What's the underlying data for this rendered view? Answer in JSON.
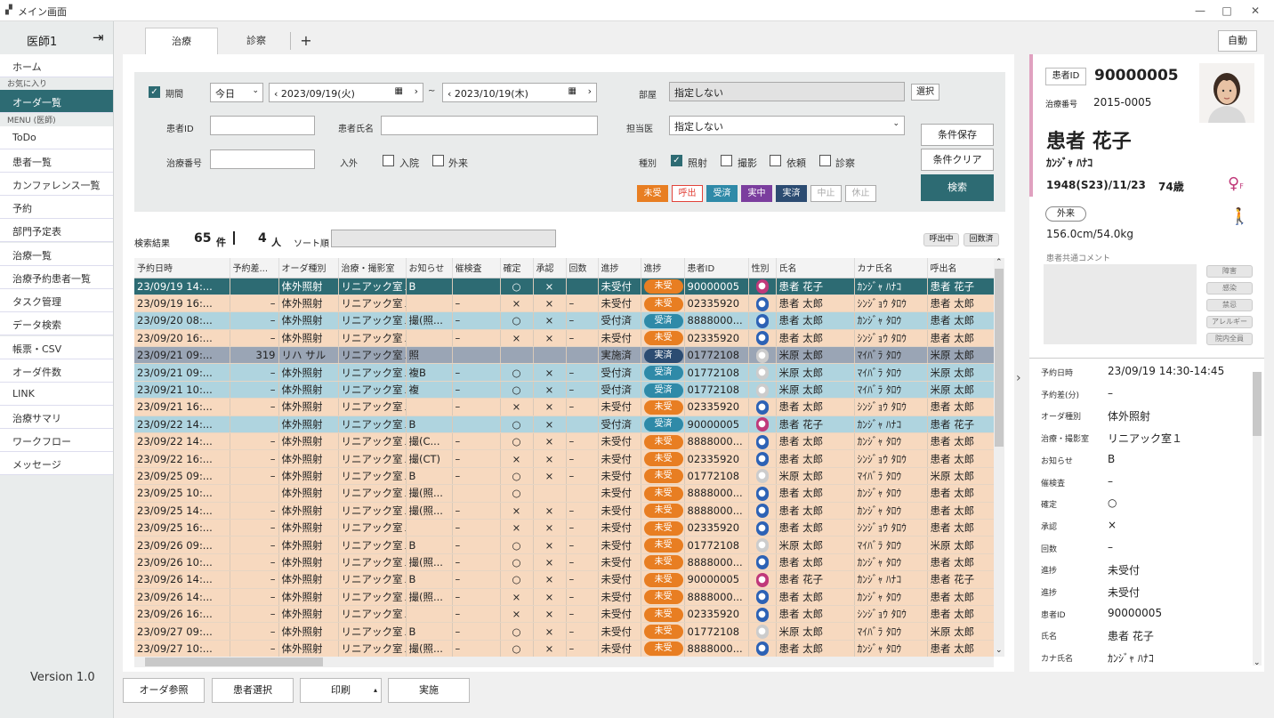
{
  "window": {
    "title": "メイン画面",
    "minimize": "—",
    "maximize": "□",
    "close": "✕"
  },
  "sidebar": {
    "user": "医師1",
    "cat_fav": "お気に入り",
    "cat_menu": "MENU (医師)",
    "version": "Version 1.0",
    "items": [
      "ホーム",
      "オーダ一覧",
      "ToDo",
      "患者一覧",
      "カンファレンス一覧",
      "予約",
      "部門予定表",
      "治療一覧",
      "治療予約患者一覧",
      "タスク管理",
      "データ検索",
      "帳票・CSV",
      "オーダ件数",
      "LINK",
      "治療サマリ",
      "ワークフロー",
      "メッセージ"
    ]
  },
  "tabs": [
    "治療",
    "診察"
  ],
  "tab_add": "+",
  "auto_button": "自動",
  "search": {
    "period_label": "期間",
    "today": "今日",
    "date_from": "2023/09/19(火)",
    "tilde": "~",
    "date_to": "2023/10/19(木)",
    "patient_id_label": "患者ID",
    "patient_name_label": "患者氏名",
    "treat_no_label": "治療番号",
    "inout_label": "入外",
    "inpatient": "入院",
    "outpatient": "外来",
    "dept_label": "部屋",
    "dept_value": "指定しない",
    "select_button": "選択",
    "staff_label": "担当医",
    "staff_value": "指定しない",
    "type_label": "種別",
    "type_irr": "照射",
    "type_img": "撮影",
    "type_req": "依頼",
    "type_exam": "診察",
    "save_cond": "条件保存",
    "clear_cond": "条件クリア",
    "search_button": "検索",
    "statuses": [
      {
        "label": "未受",
        "bg": "#e87e22",
        "fg": "#ffffff",
        "border": "#e87e22"
      },
      {
        "label": "呼出",
        "bg": "#ffffff",
        "fg": "#e2433a",
        "border": "#e2433a"
      },
      {
        "label": "受済",
        "bg": "#2f8aa8",
        "fg": "#ffffff",
        "border": "#2f8aa8"
      },
      {
        "label": "実中",
        "bg": "#7b3e9e",
        "fg": "#ffffff",
        "border": "#7b3e9e"
      },
      {
        "label": "実済",
        "bg": "#2c4c72",
        "fg": "#ffffff",
        "border": "#2c4c72"
      },
      {
        "label": "中止",
        "bg": "#ffffff",
        "fg": "#aaaaaa",
        "border": "#aaaaaa"
      },
      {
        "label": "休止",
        "bg": "#ffffff",
        "fg": "#aaaaaa",
        "border": "#aaaaaa"
      }
    ]
  },
  "results": {
    "label": "検索結果",
    "count": "65",
    "count_unit": "件",
    "people": "4",
    "people_unit": "人",
    "sort_label": "ソート順",
    "btn_calling": "呼出中",
    "btn_registered": "回数済"
  },
  "table": {
    "headers": [
      "予約日時",
      "予約差...",
      "オーダ種別",
      "治療・撮影室",
      "お知らせ",
      "催検査",
      "確定",
      "承認",
      "回数",
      "進捗",
      "進捗",
      "患者ID",
      "性別",
      "氏名",
      "カナ氏名",
      "呼出名"
    ],
    "rows": [
      {
        "style": "sel",
        "date": "23/09/19  14:...",
        "diff": "",
        "order": "体外照射",
        "room": "リニアック室１",
        "notice": "B",
        "exam": "",
        "kakutei": "○",
        "shonin": "×",
        "count": "",
        "prog": "未受付",
        "status": "未受",
        "stcls": "st-orange",
        "pid": "90000005",
        "sex": "f",
        "name": "患者  花子",
        "kana": "ｶﾝｼﾞｬ ﾊﾅｺ",
        "call": "患者  花子"
      },
      {
        "style": "peach",
        "date": "23/09/19  16:...",
        "diff": "–",
        "order": "体外照射",
        "room": "リニアック室１",
        "notice": "",
        "exam": "–",
        "kakutei": "×",
        "shonin": "×",
        "count": "–",
        "prog": "未受付",
        "status": "未受",
        "stcls": "st-orange",
        "pid": "02335920",
        "sex": "m",
        "name": "患者  太郎",
        "kana": "ｼﾝｼﾞｮｳ ﾀﾛｳ",
        "call": "患者  太郎"
      },
      {
        "style": "blue",
        "date": "23/09/20  08:...",
        "diff": "–",
        "order": "体外照射",
        "room": "リニアック室１",
        "notice": "撮(照...",
        "exam": "–",
        "kakutei": "○",
        "shonin": "×",
        "count": "–",
        "prog": "受付済",
        "status": "受済",
        "stcls": "st-teal",
        "pid": "8888000...",
        "sex": "m",
        "name": "患者  太郎",
        "kana": "ｶﾝｼﾞｬ ﾀﾛｳ",
        "call": "患者  太郎"
      },
      {
        "style": "peach",
        "date": "23/09/20  16:...",
        "diff": "–",
        "order": "体外照射",
        "room": "リニアック室１",
        "notice": "",
        "exam": "–",
        "kakutei": "×",
        "shonin": "×",
        "count": "–",
        "prog": "未受付",
        "status": "未受",
        "stcls": "st-orange",
        "pid": "02335920",
        "sex": "m",
        "name": "患者  太郎",
        "kana": "ｼﾝｼﾞｮｳ ﾀﾛｳ",
        "call": "患者  太郎"
      },
      {
        "style": "gray",
        "date": "23/09/21  09:...",
        "diff": "319",
        "order": "リハ  サル",
        "room": "リニアック室１",
        "notice": "照",
        "exam": "",
        "kakutei": "",
        "shonin": "",
        "count": "",
        "prog": "実施済",
        "status": "実済",
        "stcls": "st-navy",
        "pid": "01772108",
        "sex": "u",
        "name": "米原  太郎",
        "kana": "ﾏｲﾊﾞﾗ ﾀﾛｳ",
        "call": "米原  太郎"
      },
      {
        "style": "blue",
        "date": "23/09/21  09:...",
        "diff": "–",
        "order": "体外照射",
        "room": "リニアック室１",
        "notice": "複B",
        "exam": "–",
        "kakutei": "○",
        "shonin": "×",
        "count": "–",
        "prog": "受付済",
        "status": "受済",
        "stcls": "st-teal",
        "pid": "01772108",
        "sex": "u",
        "name": "米原  太郎",
        "kana": "ﾏｲﾊﾞﾗ ﾀﾛｳ",
        "call": "米原  太郎"
      },
      {
        "style": "blue",
        "date": "23/09/21  10:...",
        "diff": "–",
        "order": "体外照射",
        "room": "リニアック室１",
        "notice": "複",
        "exam": "–",
        "kakutei": "○",
        "shonin": "×",
        "count": "–",
        "prog": "受付済",
        "status": "受済",
        "stcls": "st-teal",
        "pid": "01772108",
        "sex": "u",
        "name": "米原  太郎",
        "kana": "ﾏｲﾊﾞﾗ ﾀﾛｳ",
        "call": "米原  太郎"
      },
      {
        "style": "peach",
        "date": "23/09/21  16:...",
        "diff": "–",
        "order": "体外照射",
        "room": "リニアック室１",
        "notice": "",
        "exam": "–",
        "kakutei": "×",
        "shonin": "×",
        "count": "–",
        "prog": "未受付",
        "status": "未受",
        "stcls": "st-orange",
        "pid": "02335920",
        "sex": "m",
        "name": "患者  太郎",
        "kana": "ｼﾝｼﾞｮｳ ﾀﾛｳ",
        "call": "患者  太郎"
      },
      {
        "style": "blue",
        "date": "23/09/22  14:...",
        "diff": "",
        "order": "体外照射",
        "room": "リニアック室１",
        "notice": "B",
        "exam": "",
        "kakutei": "○",
        "shonin": "×",
        "count": "",
        "prog": "受付済",
        "status": "受済",
        "stcls": "st-teal",
        "pid": "90000005",
        "sex": "f",
        "name": "患者  花子",
        "kana": "ｶﾝｼﾞｬ ﾊﾅｺ",
        "call": "患者  花子"
      },
      {
        "style": "peach",
        "date": "23/09/22  14:...",
        "diff": "–",
        "order": "体外照射",
        "room": "リニアック室１",
        "notice": "撮(C...",
        "exam": "–",
        "kakutei": "○",
        "shonin": "×",
        "count": "–",
        "prog": "未受付",
        "status": "未受",
        "stcls": "st-orange",
        "pid": "8888000...",
        "sex": "m",
        "name": "患者  太郎",
        "kana": "ｶﾝｼﾞｬ ﾀﾛｳ",
        "call": "患者  太郎"
      },
      {
        "style": "peach",
        "date": "23/09/22  16:...",
        "diff": "–",
        "order": "体外照射",
        "room": "リニアック室１",
        "notice": "撮(CT)",
        "exam": "–",
        "kakutei": "×",
        "shonin": "×",
        "count": "–",
        "prog": "未受付",
        "status": "未受",
        "stcls": "st-orange",
        "pid": "02335920",
        "sex": "m",
        "name": "患者  太郎",
        "kana": "ｼﾝｼﾞｮｳ ﾀﾛｳ",
        "call": "患者  太郎"
      },
      {
        "style": "peach",
        "date": "23/09/25  09:...",
        "diff": "–",
        "order": "体外照射",
        "room": "リニアック室１",
        "notice": "B",
        "exam": "–",
        "kakutei": "○",
        "shonin": "×",
        "count": "–",
        "prog": "未受付",
        "status": "未受",
        "stcls": "st-orange",
        "pid": "01772108",
        "sex": "u",
        "name": "米原  太郎",
        "kana": "ﾏｲﾊﾞﾗ ﾀﾛｳ",
        "call": "米原  太郎"
      },
      {
        "style": "peach",
        "date": "23/09/25  10:...",
        "diff": "",
        "order": "体外照射",
        "room": "リニアック室１",
        "notice": "撮(照...",
        "exam": "",
        "kakutei": "○",
        "shonin": "",
        "count": "",
        "prog": "未受付",
        "status": "未受",
        "stcls": "st-orange",
        "pid": "8888000...",
        "sex": "m",
        "name": "患者  太郎",
        "kana": "ｶﾝｼﾞｬ ﾀﾛｳ",
        "call": "患者  太郎"
      },
      {
        "style": "peach",
        "date": "23/09/25  14:...",
        "diff": "–",
        "order": "体外照射",
        "room": "リニアック室１",
        "notice": "撮(照...",
        "exam": "–",
        "kakutei": "×",
        "shonin": "×",
        "count": "–",
        "prog": "未受付",
        "status": "未受",
        "stcls": "st-orange",
        "pid": "8888000...",
        "sex": "m",
        "name": "患者  太郎",
        "kana": "ｶﾝｼﾞｬ ﾀﾛｳ",
        "call": "患者  太郎"
      },
      {
        "style": "peach",
        "date": "23/09/25  16:...",
        "diff": "–",
        "order": "体外照射",
        "room": "リニアック室１",
        "notice": "",
        "exam": "–",
        "kakutei": "×",
        "shonin": "×",
        "count": "–",
        "prog": "未受付",
        "status": "未受",
        "stcls": "st-orange",
        "pid": "02335920",
        "sex": "m",
        "name": "患者  太郎",
        "kana": "ｼﾝｼﾞｮｳ ﾀﾛｳ",
        "call": "患者  太郎"
      },
      {
        "style": "peach",
        "date": "23/09/26  09:...",
        "diff": "–",
        "order": "体外照射",
        "room": "リニアック室１",
        "notice": "B",
        "exam": "–",
        "kakutei": "○",
        "shonin": "×",
        "count": "–",
        "prog": "未受付",
        "status": "未受",
        "stcls": "st-orange",
        "pid": "01772108",
        "sex": "u",
        "name": "米原  太郎",
        "kana": "ﾏｲﾊﾞﾗ ﾀﾛｳ",
        "call": "米原  太郎"
      },
      {
        "style": "peach",
        "date": "23/09/26  10:...",
        "diff": "–",
        "order": "体外照射",
        "room": "リニアック室１",
        "notice": "撮(照...",
        "exam": "–",
        "kakutei": "○",
        "shonin": "×",
        "count": "–",
        "prog": "未受付",
        "status": "未受",
        "stcls": "st-orange",
        "pid": "8888000...",
        "sex": "m",
        "name": "患者  太郎",
        "kana": "ｶﾝｼﾞｬ ﾀﾛｳ",
        "call": "患者  太郎"
      },
      {
        "style": "peach",
        "date": "23/09/26  14:...",
        "diff": "–",
        "order": "体外照射",
        "room": "リニアック室１",
        "notice": "B",
        "exam": "–",
        "kakutei": "○",
        "shonin": "×",
        "count": "–",
        "prog": "未受付",
        "status": "未受",
        "stcls": "st-orange",
        "pid": "90000005",
        "sex": "f",
        "name": "患者  花子",
        "kana": "ｶﾝｼﾞｬ ﾊﾅｺ",
        "call": "患者  花子"
      },
      {
        "style": "peach",
        "date": "23/09/26  14:...",
        "diff": "–",
        "order": "体外照射",
        "room": "リニアック室１",
        "notice": "撮(照...",
        "exam": "–",
        "kakutei": "×",
        "shonin": "×",
        "count": "–",
        "prog": "未受付",
        "status": "未受",
        "stcls": "st-orange",
        "pid": "8888000...",
        "sex": "m",
        "name": "患者  太郎",
        "kana": "ｶﾝｼﾞｬ ﾀﾛｳ",
        "call": "患者  太郎"
      },
      {
        "style": "peach",
        "date": "23/09/26  16:...",
        "diff": "–",
        "order": "体外照射",
        "room": "リニアック室１",
        "notice": "",
        "exam": "–",
        "kakutei": "×",
        "shonin": "×",
        "count": "–",
        "prog": "未受付",
        "status": "未受",
        "stcls": "st-orange",
        "pid": "02335920",
        "sex": "m",
        "name": "患者  太郎",
        "kana": "ｼﾝｼﾞｮｳ ﾀﾛｳ",
        "call": "患者  太郎"
      },
      {
        "style": "peach",
        "date": "23/09/27  09:...",
        "diff": "–",
        "order": "体外照射",
        "room": "リニアック室１",
        "notice": "B",
        "exam": "–",
        "kakutei": "○",
        "shonin": "×",
        "count": "–",
        "prog": "未受付",
        "status": "未受",
        "stcls": "st-orange",
        "pid": "01772108",
        "sex": "u",
        "name": "米原  太郎",
        "kana": "ﾏｲﾊﾞﾗ ﾀﾛｳ",
        "call": "米原  太郎"
      },
      {
        "style": "peach",
        "date": "23/09/27  10:...",
        "diff": "–",
        "order": "体外照射",
        "room": "リニアック室１",
        "notice": "撮(照...",
        "exam": "–",
        "kakutei": "○",
        "shonin": "×",
        "count": "–",
        "prog": "未受付",
        "status": "未受",
        "stcls": "st-orange",
        "pid": "8888000...",
        "sex": "m",
        "name": "患者  太郎",
        "kana": "ｶﾝｼﾞｬ ﾀﾛｳ",
        "call": "患者  太郎"
      }
    ]
  },
  "footer": {
    "order_ref": "オーダ参照",
    "patient_select": "患者選択",
    "print": "印刷",
    "execute": "実施"
  },
  "patient": {
    "id_label": "患者ID",
    "id": "90000005",
    "treat_no_label": "治療番号",
    "treat_no": "2015-0005",
    "name": "患者  花子",
    "kana": "ｶﾝｼﾞｬ ﾊﾅｺ",
    "birth": "1948(S23)/11/23",
    "age": "74歳",
    "sex_mark": "F",
    "visit_type": "外来",
    "height_weight": "156.0cm/54.0kg",
    "comment_label": "患者共通コメント",
    "tags": [
      "障害",
      "感染",
      "禁忌",
      "アレルギー",
      "院内全員"
    ]
  },
  "detail": {
    "rows": [
      {
        "label": "予約日時",
        "value": "23/09/19  14:30-14:45"
      },
      {
        "label": "予約差(分)",
        "value": "–"
      },
      {
        "label": "オーダ種別",
        "value": "体外照射"
      },
      {
        "label": "治療・撮影室",
        "value": "リニアック室１"
      },
      {
        "label": "お知らせ",
        "value": "B"
      },
      {
        "label": "催検査",
        "value": "–"
      },
      {
        "label": "確定",
        "value": "○"
      },
      {
        "label": "承認",
        "value": "×"
      },
      {
        "label": "回数",
        "value": "–"
      },
      {
        "label": "進捗",
        "value": "未受付"
      },
      {
        "label": "進捗",
        "value": "未受付"
      },
      {
        "label": "患者ID",
        "value": "90000005"
      },
      {
        "label": "氏名",
        "value": "患者  花子"
      },
      {
        "label": "カナ氏名",
        "value": "ｶﾝｼﾞｬ ﾊﾅｺ"
      }
    ]
  }
}
